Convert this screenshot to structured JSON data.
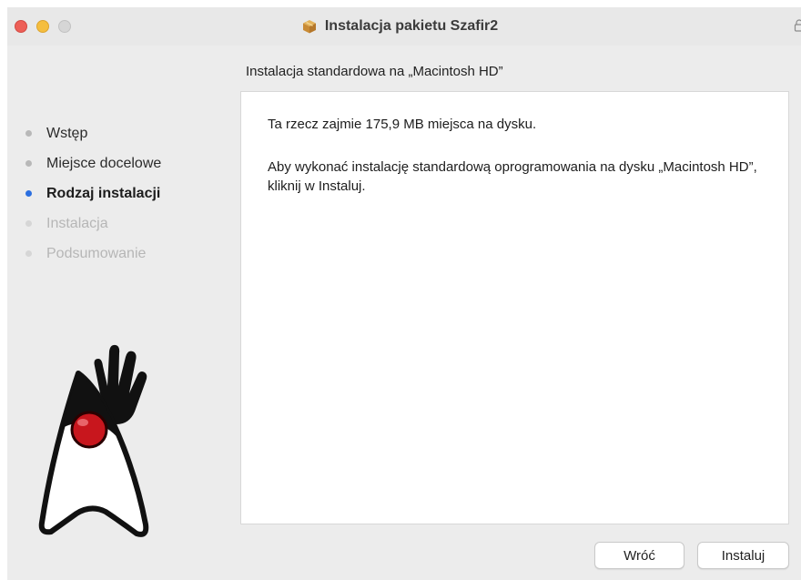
{
  "window": {
    "title": "Instalacja pakietu Szafir2",
    "title_icon": "package-icon",
    "lock_icon": "lock-icon"
  },
  "subtitle": "Instalacja standardowa na „Macintosh HD”",
  "steps": [
    {
      "label": "Wstęp",
      "state": "done"
    },
    {
      "label": "Miejsce docelowe",
      "state": "done"
    },
    {
      "label": "Rodzaj instalacji",
      "state": "active"
    },
    {
      "label": "Instalacja",
      "state": "pending"
    },
    {
      "label": "Podsumowanie",
      "state": "pending"
    }
  ],
  "content": {
    "size_text": "Ta rzecz zajmie 175,9 MB miejsca na dysku.",
    "instruction_text": "Aby wykonać instalację standardową oprogramowania na dysku „Macintosh HD”, kliknij w Instaluj."
  },
  "buttons": {
    "back_label": "Wróć",
    "install_label": "Instaluj"
  },
  "colors": {
    "active_step_dot": "#2b6fe0",
    "close_button": "#ed5f57",
    "minimize_button": "#f5be3f",
    "mascot_nose": "#c8161d"
  },
  "icons": [
    "package-icon",
    "lock-icon",
    "java-duke-mascot"
  ]
}
